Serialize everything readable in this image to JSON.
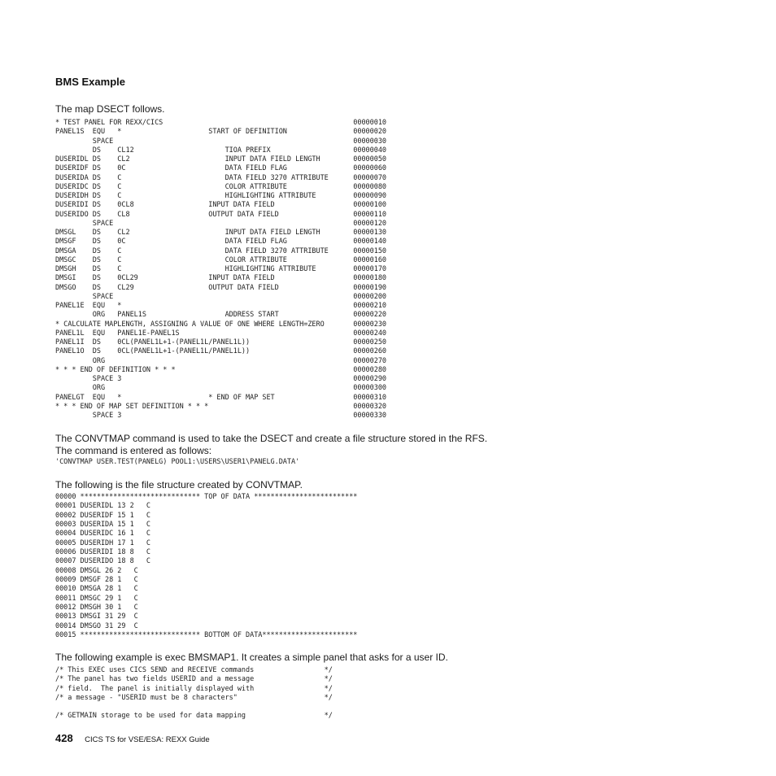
{
  "heading": "BMS Example",
  "intro": "The map DSECT follows.",
  "dsect_lines": [
    "* TEST PANEL FOR REXX/CICS                                              00000010",
    "PANEL1S  EQU   *                     START OF DEFINITION                00000020",
    "         SPACE                                                          00000030",
    "         DS    CL12                      TIOA PREFIX                    00000040",
    "DUSERIDL DS    CL2                       INPUT DATA FIELD LENGTH        00000050",
    "DUSERIDF DS    0C                        DATA FIELD FLAG                00000060",
    "DUSERIDA DS    C                         DATA FIELD 3270 ATTRIBUTE      00000070",
    "DUSERIDC DS    C                         COLOR ATTRIBUTE                00000080",
    "DUSERIDH DS    C                         HIGHLIGHTING ATTRIBUTE         00000090",
    "DUSERIDI DS    0CL8                  INPUT DATA FIELD                   00000100",
    "DUSERIDO DS    CL8                   OUTPUT DATA FIELD                  00000110",
    "         SPACE                                                          00000120",
    "DMSGL    DS    CL2                       INPUT DATA FIELD LENGTH        00000130",
    "DMSGF    DS    0C                        DATA FIELD FLAG                00000140",
    "DMSGA    DS    C                         DATA FIELD 3270 ATTRIBUTE      00000150",
    "DMSGC    DS    C                         COLOR ATTRIBUTE                00000160",
    "DMSGH    DS    C                         HIGHLIGHTING ATTRIBUTE         00000170",
    "DMSGI    DS    0CL29                 INPUT DATA FIELD                   00000180",
    "DMSGO    DS    CL29                  OUTPUT DATA FIELD                  00000190",
    "         SPACE                                                          00000200",
    "PANEL1E  EQU   *                                                        00000210",
    "         ORG   PANEL1S                   ADDRESS START                  00000220",
    "* CALCULATE MAPLENGTH, ASSIGNING A VALUE OF ONE WHERE LENGTH=ZERO       00000230",
    "PANEL1L  EQU   PANEL1E-PANEL1S                                          00000240",
    "PANEL1I  DS    0CL(PANEL1L+1-(PANEL1L/PANEL1L))                         00000250",
    "PANEL1O  DS    0CL(PANEL1L+1-(PANEL1L/PANEL1L))                         00000260",
    "         ORG                                                            00000270",
    "* * * END OF DEFINITION * * *                                           00000280",
    "         SPACE 3                                                        00000290",
    "         ORG                                                            00000300",
    "PANELGT  EQU   *                     * END OF MAP SET                   00000310",
    "* * * END OF MAP SET DEFINITION * * *                                   00000320",
    "         SPACE 3                                                        00000330"
  ],
  "convtmap_para": "The CONVTMAP command is used to take the DSECT and create a file structure stored in the RFS. The command is entered as follows:",
  "convtmap_command": "'CONVTMAP USER.TEST(PANELG) POOL1:\\USERS\\USER1\\PANELG.DATA'",
  "file_structure_para": "The following is the file structure created by CONVTMAP.",
  "file_structure_lines": [
    "00000 ***************************** TOP OF DATA *************************",
    "00001 DUSERIDL 13 2   C",
    "00002 DUSERIDF 15 1   C",
    "00003 DUSERIDA 15 1   C",
    "00004 DUSERIDC 16 1   C",
    "00005 DUSERIDH 17 1   C",
    "00006 DUSERIDI 18 8   C",
    "00007 DUSERIDO 18 8   C",
    "00008 DMSGL 26 2   C",
    "00009 DMSGF 28 1   C",
    "00010 DMSGA 28 1   C",
    "00011 DMSGC 29 1   C",
    "00012 DMSGH 30 1   C",
    "00013 DMSGI 31 29  C",
    "00014 DMSGO 31 29  C",
    "00015 ***************************** BOTTOM OF DATA***********************"
  ],
  "exec_para": "The following example is exec BMSMAP1. It creates a simple panel that asks for a user ID.",
  "exec_lines": [
    "/* This EXEC uses CICS SEND and RECEIVE commands                 */",
    "/* The panel has two fields USERID and a message                 */",
    "/* field.  The panel is initially displayed with                 */",
    "/* a message - \"USERID must be 8 characters\"                     */",
    "",
    "/* GETMAIN storage to be used for data mapping                   */"
  ],
  "footer": {
    "page_number": "428",
    "book_title": "CICS TS for VSE/ESA:  REXX Guide"
  }
}
